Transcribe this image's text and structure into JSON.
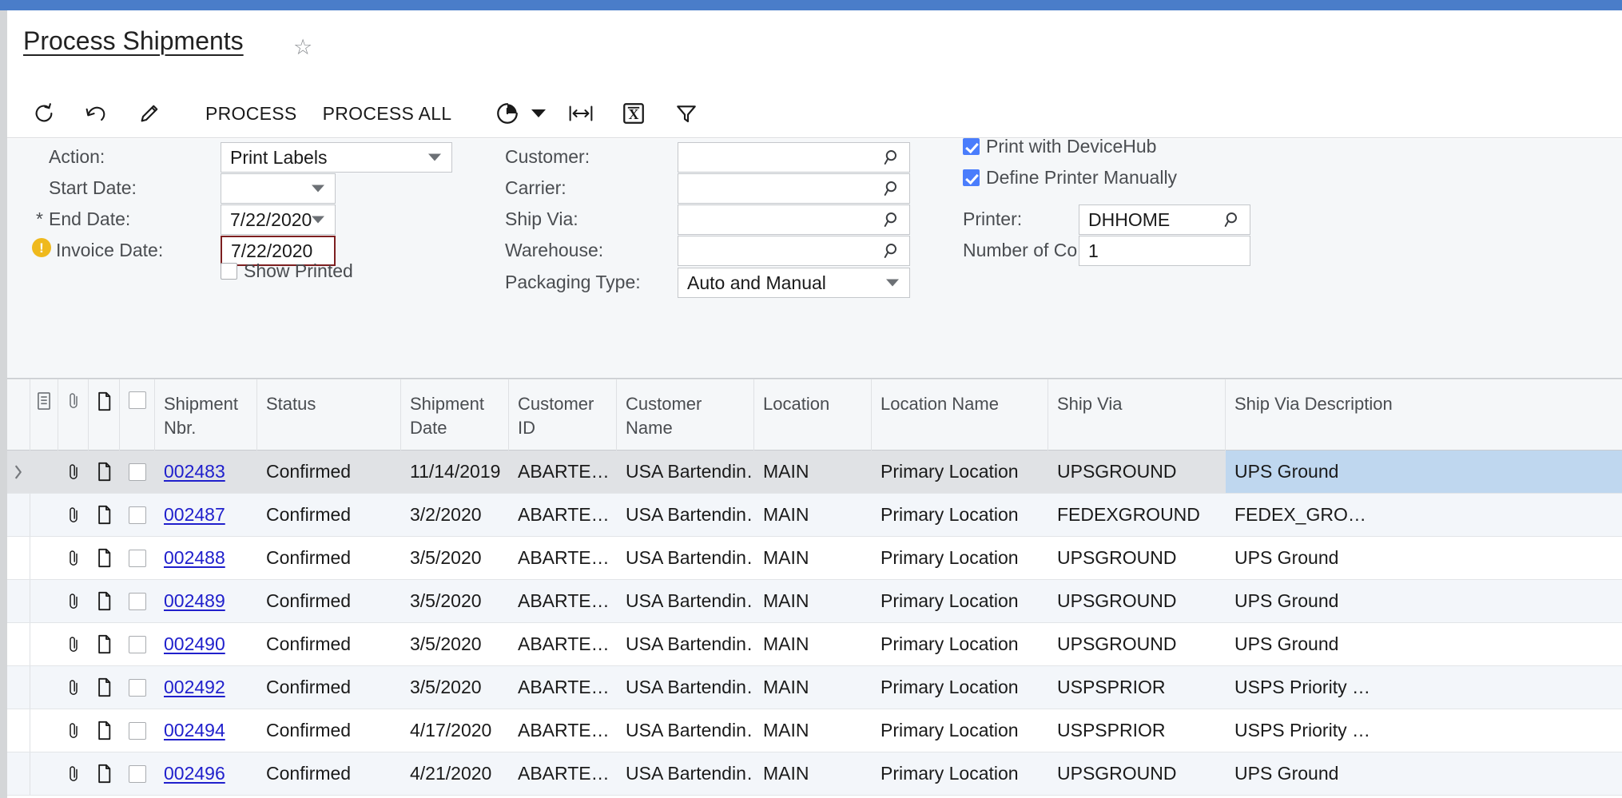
{
  "theme": {
    "topbar_color": "#4a7dc9",
    "accent_link": "#2020cc",
    "selected_cell": "#bfd7ef",
    "selected_row": "#e0e2e5",
    "error_border": "#7d1f20",
    "warning_icon": "#efb91d",
    "checkbox_on": "#4a7dfc"
  },
  "header": {
    "title": "Process Shipments",
    "favorite_icon": "star-icon"
  },
  "toolbar": {
    "refresh_label": "refresh-icon",
    "undo_label": "undo-icon",
    "edit_label": "edit-pencil-icon",
    "process_label": "PROCESS",
    "process_all_label": "PROCESS ALL",
    "history_label": "history-clock-icon",
    "history_caret": "chevron-down-icon",
    "fit_label": "fit-to-width-icon",
    "export_label": "export-excel-icon",
    "filter_label": "filter-funnel-icon"
  },
  "criteria": {
    "col1": [
      {
        "label": "Action:",
        "required": false,
        "warning": false,
        "type": "select",
        "value": "Print Labels"
      },
      {
        "label": "Start Date:",
        "required": false,
        "warning": false,
        "type": "date",
        "value": ""
      },
      {
        "label": "End Date:",
        "required": true,
        "warning": false,
        "type": "date",
        "value": "7/22/2020"
      },
      {
        "label": "Invoice Date:",
        "required": false,
        "warning": true,
        "type": "text-error",
        "value": "7/22/2020"
      }
    ],
    "show_printed": {
      "label": "Show Printed",
      "checked": false
    },
    "col2": [
      {
        "label": "Customer:",
        "type": "lookup",
        "value": ""
      },
      {
        "label": "Carrier:",
        "type": "lookup",
        "value": ""
      },
      {
        "label": "Ship Via:",
        "type": "lookup",
        "value": ""
      },
      {
        "label": "Warehouse:",
        "type": "lookup",
        "value": ""
      },
      {
        "label": "Packaging Type:",
        "type": "select",
        "value": "Auto and Manual"
      }
    ],
    "col3": {
      "print_with_devicehub": {
        "label": "Print with DeviceHub",
        "checked": true
      },
      "define_printer_manually": {
        "label": "Define Printer Manually",
        "checked": true
      },
      "printer": {
        "label": "Printer:",
        "type": "lookup",
        "value": "DHHOME"
      },
      "number_of_copies": {
        "label": "Number of Co…",
        "type": "text",
        "value": "1"
      }
    }
  },
  "grid": {
    "icon_columns": [
      "notes-icon",
      "paperclip-icon",
      "document-icon",
      "checkbox-icon"
    ],
    "columns": [
      "Shipment Nbr.",
      "Status",
      "Shipment Date",
      "Customer ID",
      "Customer Name",
      "Location",
      "Location Name",
      "Ship Via",
      "Ship Via Description"
    ],
    "rows": [
      {
        "shipment_nbr": "002483",
        "status": "Confirmed",
        "shipment_date": "11/14/2019",
        "customer_id": "ABARTE…",
        "customer_name": "USA Bartendin…",
        "location": "MAIN",
        "location_name": "Primary Location",
        "ship_via": "UPSGROUND",
        "ship_via_description": "UPS Ground",
        "selected": true,
        "checked": false
      },
      {
        "shipment_nbr": "002487",
        "status": "Confirmed",
        "shipment_date": "3/2/2020",
        "customer_id": "ABARTE…",
        "customer_name": "USA Bartendin…",
        "location": "MAIN",
        "location_name": "Primary Location",
        "ship_via": "FEDEXGROUND",
        "ship_via_description": "FEDEX_GRO…",
        "selected": false,
        "checked": false
      },
      {
        "shipment_nbr": "002488",
        "status": "Confirmed",
        "shipment_date": "3/5/2020",
        "customer_id": "ABARTE…",
        "customer_name": "USA Bartendin…",
        "location": "MAIN",
        "location_name": "Primary Location",
        "ship_via": "UPSGROUND",
        "ship_via_description": "UPS Ground",
        "selected": false,
        "checked": false
      },
      {
        "shipment_nbr": "002489",
        "status": "Confirmed",
        "shipment_date": "3/5/2020",
        "customer_id": "ABARTE…",
        "customer_name": "USA Bartendin…",
        "location": "MAIN",
        "location_name": "Primary Location",
        "ship_via": "UPSGROUND",
        "ship_via_description": "UPS Ground",
        "selected": false,
        "checked": false
      },
      {
        "shipment_nbr": "002490",
        "status": "Confirmed",
        "shipment_date": "3/5/2020",
        "customer_id": "ABARTE…",
        "customer_name": "USA Bartendin…",
        "location": "MAIN",
        "location_name": "Primary Location",
        "ship_via": "UPSGROUND",
        "ship_via_description": "UPS Ground",
        "selected": false,
        "checked": false
      },
      {
        "shipment_nbr": "002492",
        "status": "Confirmed",
        "shipment_date": "3/5/2020",
        "customer_id": "ABARTE…",
        "customer_name": "USA Bartendin…",
        "location": "MAIN",
        "location_name": "Primary Location",
        "ship_via": "USPSPRIOR",
        "ship_via_description": "USPS Priority …",
        "selected": false,
        "checked": false
      },
      {
        "shipment_nbr": "002494",
        "status": "Confirmed",
        "shipment_date": "4/17/2020",
        "customer_id": "ABARTE…",
        "customer_name": "USA Bartendin…",
        "location": "MAIN",
        "location_name": "Primary Location",
        "ship_via": "USPSPRIOR",
        "ship_via_description": "USPS Priority …",
        "selected": false,
        "checked": false
      },
      {
        "shipment_nbr": "002496",
        "status": "Confirmed",
        "shipment_date": "4/21/2020",
        "customer_id": "ABARTE…",
        "customer_name": "USA Bartendin…",
        "location": "MAIN",
        "location_name": "Primary Location",
        "ship_via": "UPSGROUND",
        "ship_via_description": "UPS Ground",
        "selected": false,
        "checked": false
      }
    ]
  }
}
